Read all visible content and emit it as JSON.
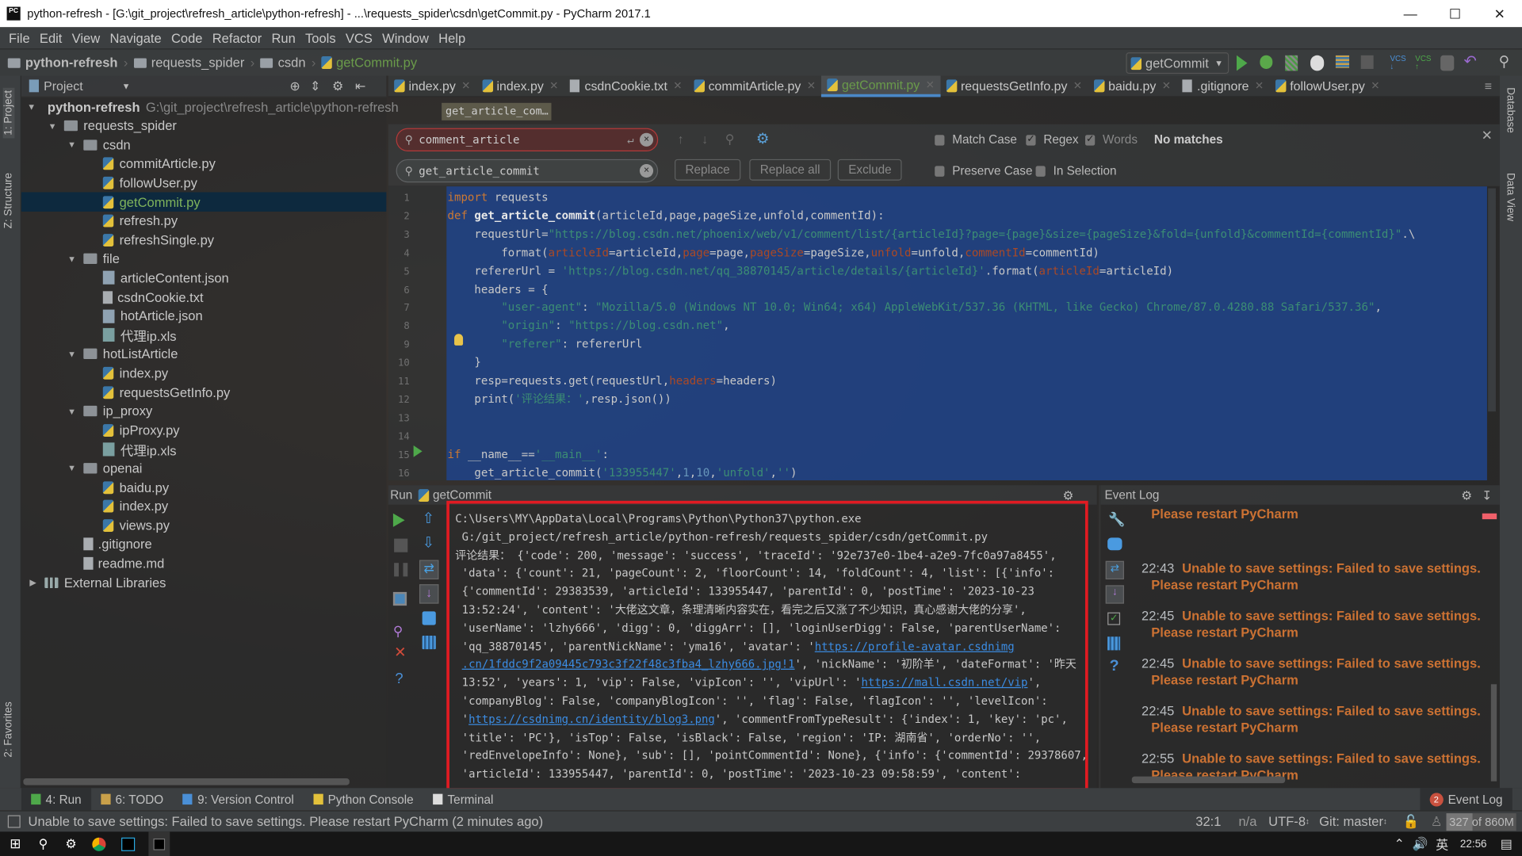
{
  "window": {
    "title": "python-refresh - [G:\\git_project\\refresh_article\\python-refresh] - ...\\requests_spider\\csdn\\getCommit.py - PyCharm 2017.1",
    "app_icon": "PC"
  },
  "menu": [
    "File",
    "Edit",
    "View",
    "Navigate",
    "Code",
    "Refactor",
    "Run",
    "Tools",
    "VCS",
    "Window",
    "Help"
  ],
  "breadcrumb": [
    "python-refresh",
    "requests_spider",
    "csdn",
    "getCommit.py"
  ],
  "toolbar": {
    "run_config": "getCommit"
  },
  "side_tabs": {
    "left": [
      "1: Project",
      "Z: Structure",
      "2: Favorites"
    ],
    "right": [
      "Database",
      "Data View"
    ]
  },
  "project": {
    "header": "Project",
    "tree": [
      {
        "label": "python-refresh",
        "hint": "G:\\git_project\\refresh_article\\python-refresh",
        "depth": 0,
        "type": "folder",
        "open": true,
        "bold": true
      },
      {
        "label": "requests_spider",
        "depth": 1,
        "type": "folder",
        "open": true
      },
      {
        "label": "csdn",
        "depth": 2,
        "type": "folder",
        "open": true
      },
      {
        "label": "commitArticle.py",
        "depth": 3,
        "type": "py"
      },
      {
        "label": "followUser.py",
        "depth": 3,
        "type": "py"
      },
      {
        "label": "getCommit.py",
        "depth": 3,
        "type": "py",
        "selected": true
      },
      {
        "label": "refresh.py",
        "depth": 3,
        "type": "py"
      },
      {
        "label": "refreshSingle.py",
        "depth": 3,
        "type": "py"
      },
      {
        "label": "file",
        "depth": 2,
        "type": "folder",
        "open": true
      },
      {
        "label": "articleContent.json",
        "depth": 3,
        "type": "json"
      },
      {
        "label": "csdnCookie.txt",
        "depth": 3,
        "type": "txt"
      },
      {
        "label": "hotArticle.json",
        "depth": 3,
        "type": "json"
      },
      {
        "label": "代理ip.xls",
        "depth": 3,
        "type": "xls"
      },
      {
        "label": "hotListArticle",
        "depth": 2,
        "type": "folder",
        "open": true
      },
      {
        "label": "index.py",
        "depth": 3,
        "type": "py"
      },
      {
        "label": "requestsGetInfo.py",
        "depth": 3,
        "type": "py"
      },
      {
        "label": "ip_proxy",
        "depth": 2,
        "type": "folder",
        "open": true
      },
      {
        "label": "ipProxy.py",
        "depth": 3,
        "type": "py"
      },
      {
        "label": "代理ip.xls",
        "depth": 3,
        "type": "xls"
      },
      {
        "label": "openai",
        "depth": 2,
        "type": "folder",
        "open": true
      },
      {
        "label": "baidu.py",
        "depth": 3,
        "type": "py"
      },
      {
        "label": "index.py",
        "depth": 3,
        "type": "py"
      },
      {
        "label": "views.py",
        "depth": 3,
        "type": "py"
      },
      {
        "label": ".gitignore",
        "depth": 2,
        "type": "txt"
      },
      {
        "label": "readme.md",
        "depth": 2,
        "type": "md"
      },
      {
        "label": "External Libraries",
        "depth": 0,
        "type": "lib",
        "open": false
      }
    ]
  },
  "tabs": [
    {
      "label": "index.py",
      "type": "py"
    },
    {
      "label": "index.py",
      "type": "py"
    },
    {
      "label": "csdnCookie.txt",
      "type": "txt"
    },
    {
      "label": "commitArticle.py",
      "type": "py"
    },
    {
      "label": "getCommit.py",
      "type": "py",
      "active": true
    },
    {
      "label": "requestsGetInfo.py",
      "type": "py"
    },
    {
      "label": "baidu.py",
      "type": "py"
    },
    {
      "label": ".gitignore",
      "type": "txt"
    },
    {
      "label": "followUser.py",
      "type": "py"
    }
  ],
  "tooltip": "get_article_com…",
  "find": {
    "search_value": "comment_article",
    "replace_value": "get_article_commit",
    "replace": "Replace",
    "replace_all": "Replace all",
    "exclude": "Exclude",
    "match_case": {
      "label": "Match Case",
      "checked": false
    },
    "regex": {
      "label": "Regex",
      "checked": true
    },
    "words": {
      "label": "Words",
      "checked": true
    },
    "preserve_case": {
      "label": "Preserve Case",
      "checked": false
    },
    "in_selection": {
      "label": "In Selection",
      "checked": false
    },
    "status": "No matches"
  },
  "code": [
    [
      [
        "import",
        "k"
      ],
      [
        " requests",
        "t"
      ]
    ],
    [
      [
        "def ",
        "k"
      ],
      [
        "get_article_commit",
        "f"
      ],
      [
        "(articleId,page,pageSize,unfold,commentId):",
        "t"
      ]
    ],
    [
      [
        "    requestUrl=",
        "t"
      ],
      [
        "\"https://blog.csdn.net/phoenix/web/v1/comment/list/{articleId}?page={page}&size={pageSize}&fold={unfold}&commentId={commentId}\"",
        "s"
      ],
      [
        ".\\",
        "t"
      ]
    ],
    [
      [
        "        format(",
        "t"
      ],
      [
        "articleId",
        "p"
      ],
      [
        "=articleId,",
        "t"
      ],
      [
        "page",
        "p"
      ],
      [
        "=page,",
        "t"
      ],
      [
        "pageSize",
        "p"
      ],
      [
        "=pageSize,",
        "t"
      ],
      [
        "unfold",
        "p"
      ],
      [
        "=unfold,",
        "t"
      ],
      [
        "commentId",
        "p"
      ],
      [
        "=commentId)",
        "t"
      ]
    ],
    [
      [
        "    refererUrl = ",
        "t"
      ],
      [
        "'https://blog.csdn.net/qq_38870145/article/details/{articleId}'",
        "s"
      ],
      [
        ".format(",
        "t"
      ],
      [
        "articleId",
        "p"
      ],
      [
        "=articleId)",
        "t"
      ]
    ],
    [
      [
        "    headers = {",
        "t"
      ]
    ],
    [
      [
        "        ",
        "t"
      ],
      [
        "\"user-agent\"",
        "s"
      ],
      [
        ": ",
        "t"
      ],
      [
        "\"Mozilla/5.0 (Windows NT 10.0; Win64; x64) AppleWebKit/537.36 (KHTML, like Gecko) Chrome/87.0.4280.88 Safari/537.36\"",
        "s"
      ],
      [
        ",",
        "t"
      ]
    ],
    [
      [
        "        ",
        "t"
      ],
      [
        "\"origin\"",
        "s"
      ],
      [
        ": ",
        "t"
      ],
      [
        "\"https://blog.csdn.net\"",
        "s"
      ],
      [
        ",",
        "t"
      ]
    ],
    [
      [
        "        ",
        "t"
      ],
      [
        "\"referer\"",
        "s"
      ],
      [
        ": refererUrl",
        "t"
      ]
    ],
    [
      [
        "    }",
        "t"
      ]
    ],
    [
      [
        "    resp=requests.get(requestUrl,",
        "t"
      ],
      [
        "headers",
        "p"
      ],
      [
        "=headers)",
        "t"
      ]
    ],
    [
      [
        "    print(",
        "t"
      ],
      [
        "'评论结果：'",
        "s"
      ],
      [
        ",resp.json())",
        "t"
      ]
    ],
    [],
    [],
    [
      [
        "if",
        "k"
      ],
      [
        " __name__==",
        "t"
      ],
      [
        "'__main__'",
        "s"
      ],
      [
        ":",
        "t"
      ]
    ],
    [
      [
        "    get_article_commit(",
        "t"
      ],
      [
        "'133955447'",
        "s"
      ],
      [
        ",",
        "t"
      ],
      [
        "1",
        "n"
      ],
      [
        ",",
        "t"
      ],
      [
        "10",
        "n"
      ],
      [
        ",",
        "t"
      ],
      [
        "'unfold'",
        "s"
      ],
      [
        ",",
        "t"
      ],
      [
        "''",
        "s"
      ],
      [
        ")",
        "t"
      ]
    ]
  ],
  "run": {
    "label": "Run",
    "config": "getCommit",
    "console": [
      [
        [
          "C:\\Users\\MY\\AppData\\Local\\Programs\\Python\\Python37\\python.exe",
          ""
        ]
      ],
      [
        [
          " G:/git_project/refresh_article/python-refresh/requests_spider/csdn/getCommit.py",
          ""
        ]
      ],
      [
        [
          "评论结果： {'code': 200, 'message': 'success', 'traceId': '92e737e0-1be4-a2e9-7fc0a97a8455',",
          ""
        ]
      ],
      [
        [
          " 'data': {'count': 21, 'pageCount': 2, 'floorCount': 14, 'foldCount': 4, 'list': [{'info':",
          ""
        ]
      ],
      [
        [
          " {'commentId': 29383539, 'articleId': 133955447, 'parentId': 0, 'postTime': '2023-10-23",
          ""
        ]
      ],
      [
        [
          " 13:52:24', 'content': '大佬这文章，条理清晰内容实在，看完之后又涨了不少知识，真心感谢大佬的分享',",
          ""
        ]
      ],
      [
        [
          " 'userName': 'lzhy666', 'digg': 0, 'diggArr': [], 'loginUserDigg': False, 'parentUserName':",
          ""
        ]
      ],
      [
        [
          " 'qq_38870145', 'parentNickName': 'yma16', 'avatar': '",
          ""
        ],
        [
          "https://profile-avatar.csdnimg",
          "link"
        ]
      ],
      [
        [
          " ",
          ""
        ],
        [
          ".cn/1fddc9f2a09445c793c3f22f48c3fba4_lzhy666.jpg!1",
          "link"
        ],
        [
          "', 'nickName': '初阶羊', 'dateFormat': '昨天",
          ""
        ]
      ],
      [
        [
          " 13:52', 'years': 1, 'vip': False, 'vipIcon': '', 'vipUrl': '",
          ""
        ],
        [
          "https://mall.csdn.net/vip",
          "link"
        ],
        [
          "',",
          ""
        ]
      ],
      [
        [
          " 'companyBlog': False, 'companyBlogIcon': '', 'flag': False, 'flagIcon': '', 'levelIcon':",
          ""
        ]
      ],
      [
        [
          " '",
          ""
        ],
        [
          "https://csdnimg.cn/identity/blog3.png",
          "link"
        ],
        [
          "', 'commentFromTypeResult': {'index': 1, 'key': 'pc',",
          ""
        ]
      ],
      [
        [
          " 'title': 'PC'}, 'isTop': False, 'isBlack': False, 'region': 'IP: 湖南省', 'orderNo': '',",
          ""
        ]
      ],
      [
        [
          " 'redEnvelopeInfo': None}, 'sub': [], 'pointCommentId': None}, {'info': {'commentId': 29378607,",
          ""
        ]
      ],
      [
        [
          " 'articleId': 133955447, 'parentId': 0, 'postTime': '2023-10-23 09:58:59', 'content':",
          ""
        ]
      ]
    ]
  },
  "event_log": {
    "title": "Event Log",
    "entries": [
      {
        "time": "",
        "message": "",
        "line2": "Please restart PyCharm"
      },
      {
        "time": "22:43",
        "message": "Unable to save settings: Failed to save settings.",
        "line2": "Please restart PyCharm"
      },
      {
        "time": "22:45",
        "message": "Unable to save settings: Failed to save settings.",
        "line2": "Please restart PyCharm"
      },
      {
        "time": "22:45",
        "message": "Unable to save settings: Failed to save settings.",
        "line2": "Please restart PyCharm"
      },
      {
        "time": "22:45",
        "message": "Unable to save settings: Failed to save settings.",
        "line2": "Please restart PyCharm"
      },
      {
        "time": "22:55",
        "message": "Unable to save settings: Failed to save settings.",
        "line2": "Please restart PyCharm"
      }
    ]
  },
  "bottom_tabs": [
    {
      "label": "4: Run",
      "active": true,
      "icon": "run-icon"
    },
    {
      "label": "6: TODO",
      "icon": "todo-icon"
    },
    {
      "label": "9: Version Control",
      "icon": "version-control-icon"
    },
    {
      "label": "Python Console",
      "icon": "python-console-icon"
    },
    {
      "label": "Terminal",
      "icon": "terminal-icon"
    }
  ],
  "event_log_tab": {
    "label": "Event Log",
    "badge": "2"
  },
  "status": {
    "message": "Unable to save settings: Failed to save settings. Please restart PyCharm (2 minutes ago)",
    "position": "32:1",
    "line_sep": "n/a",
    "encoding": "UTF-8",
    "git": "Git: master",
    "memory": "327 of 860M",
    "memory_used_fraction": 0.38
  },
  "taskbar": {
    "ime": "英",
    "clock": "22:56"
  },
  "colors": {
    "selection": "#214283",
    "keyword": "#cc7832",
    "string": "#3c8d74",
    "param": "#aa4926",
    "link": "#3b8ce3",
    "highlight_box": "#e11b22",
    "event_error": "#cc7233"
  }
}
